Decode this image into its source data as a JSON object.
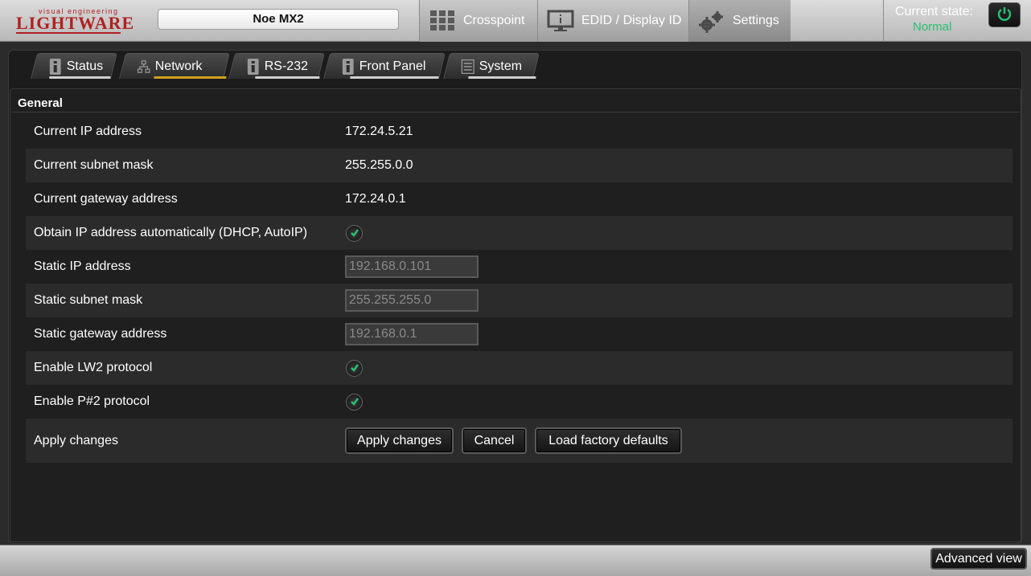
{
  "header": {
    "logo_small": "visual engineering",
    "logo_big": "LIGHTWARE",
    "device_name": "Noe MX2",
    "nav": [
      {
        "label": "Crosspoint",
        "icon": "grid-icon"
      },
      {
        "label": "EDID / Display ID",
        "icon": "monitor-icon"
      },
      {
        "label": "Settings",
        "icon": "gears-icon"
      }
    ],
    "state_label": "Current state:",
    "state_value": "Normal",
    "state_color": "#28c070"
  },
  "tabs": [
    {
      "label": "Status",
      "icon": "info-icon"
    },
    {
      "label": "Network",
      "icon": "network-icon",
      "active": true
    },
    {
      "label": "RS-232",
      "icon": "info-icon"
    },
    {
      "label": "Front Panel",
      "icon": "info-icon"
    },
    {
      "label": "System",
      "icon": "list-icon"
    }
  ],
  "section": {
    "title": "General"
  },
  "rows": {
    "current_ip": {
      "label": "Current IP address",
      "value": "172.24.5.21"
    },
    "current_mask": {
      "label": "Current subnet mask",
      "value": "255.255.0.0"
    },
    "current_gateway": {
      "label": "Current gateway address",
      "value": "172.24.0.1"
    },
    "dhcp": {
      "label": "Obtain IP address automatically (DHCP, AutoIP)",
      "checked": true
    },
    "static_ip": {
      "label": "Static IP address",
      "value": "192.168.0.101"
    },
    "static_mask": {
      "label": "Static subnet mask",
      "value": "255.255.255.0"
    },
    "static_gateway": {
      "label": "Static gateway address",
      "value": "192.168.0.1"
    },
    "lw2": {
      "label": "Enable LW2 protocol",
      "checked": true
    },
    "p2": {
      "label": "Enable P#2 protocol",
      "checked": true
    },
    "apply": {
      "label": "Apply changes"
    }
  },
  "buttons": {
    "apply": "Apply changes",
    "cancel": "Cancel",
    "factory": "Load factory defaults"
  },
  "footer": {
    "advanced_view": "Advanced view"
  },
  "colors": {
    "accent": "#d4a020",
    "check": "#28c070",
    "brand": "#b02020"
  }
}
